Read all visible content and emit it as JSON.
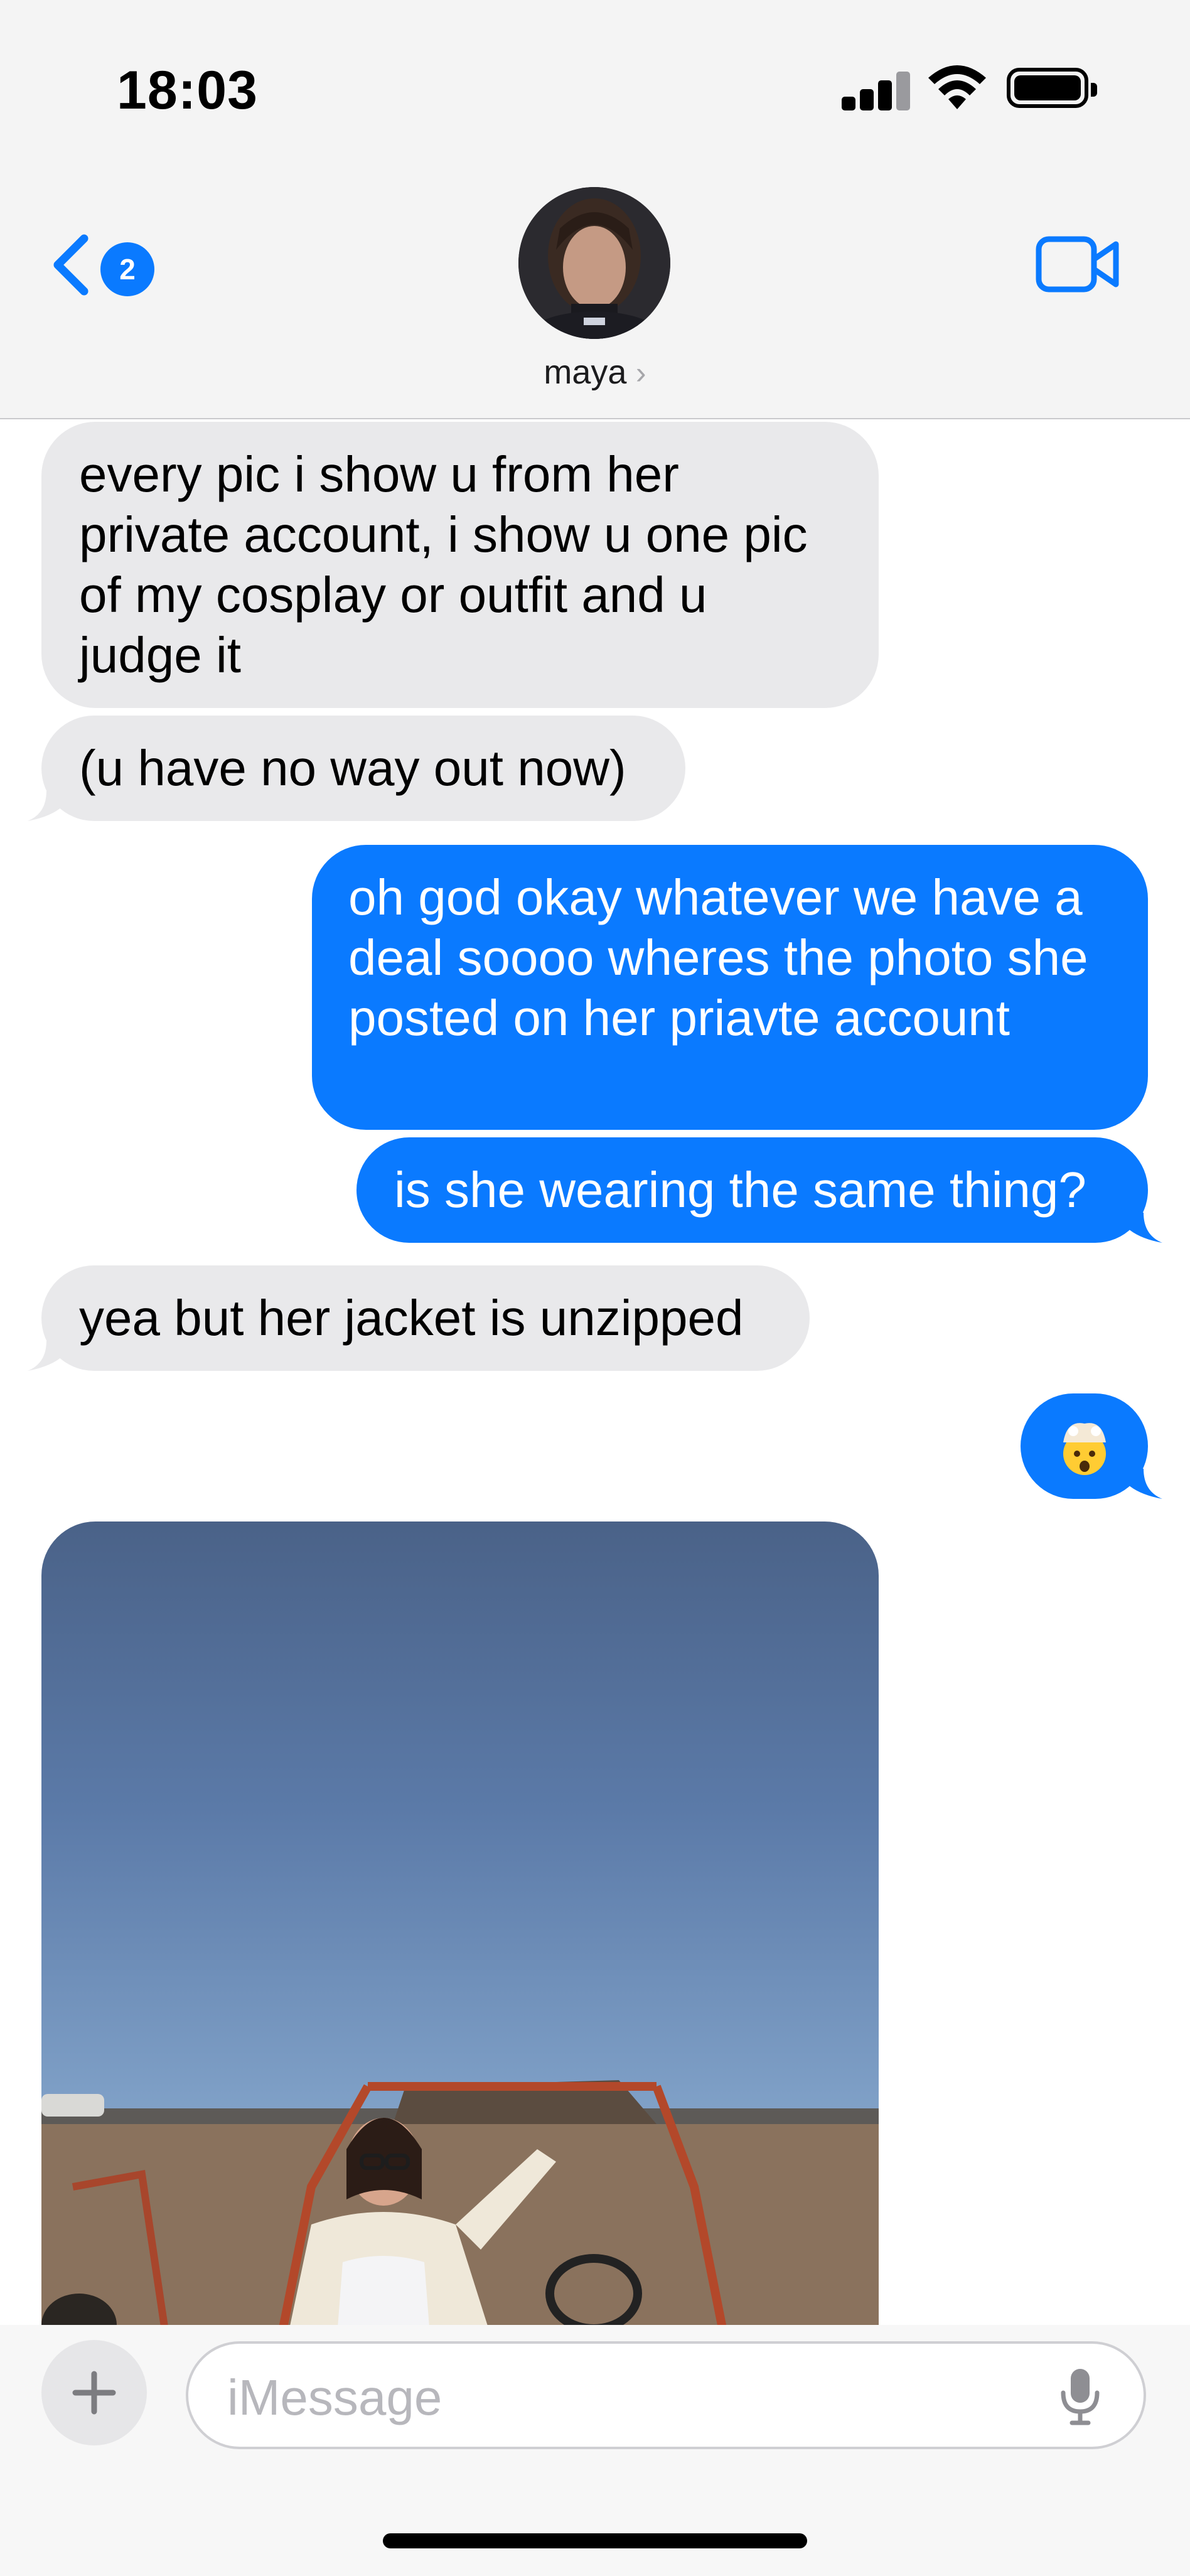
{
  "status_bar": {
    "time": "18:03",
    "icons": [
      "cellular-signal-icon",
      "wifi-icon",
      "battery-icon"
    ]
  },
  "header": {
    "back_badge": "2",
    "contact_name": "maya",
    "contact_chevron": "›",
    "icons": [
      "back-chevron-icon",
      "avatar",
      "facetime-video-icon"
    ]
  },
  "messages": [
    {
      "direction": "received",
      "text": "every pic i show u from her private account, i show u one pic of my cosplay or outfit and u judge it"
    },
    {
      "direction": "received",
      "text": "(u have no way out now)"
    },
    {
      "direction": "sent",
      "text": "oh god okay whatever we have a deal soooo wheres the photo she posted on her priavte account"
    },
    {
      "direction": "sent",
      "text": "is she wearing the same thing?"
    },
    {
      "direction": "received",
      "text": "yea but her jacket is unzipped"
    },
    {
      "direction": "sent",
      "text": "",
      "emoji": "exploding-head-emoji"
    },
    {
      "direction": "received",
      "type": "photo"
    }
  ],
  "composer": {
    "placeholder": "iMessage",
    "icons": [
      "plus-icon",
      "microphone-icon"
    ]
  },
  "colors": {
    "accent_blue": "#0a7aff",
    "received_bubble": "#e9e9eb",
    "header_bg": "#f4f4f4"
  }
}
